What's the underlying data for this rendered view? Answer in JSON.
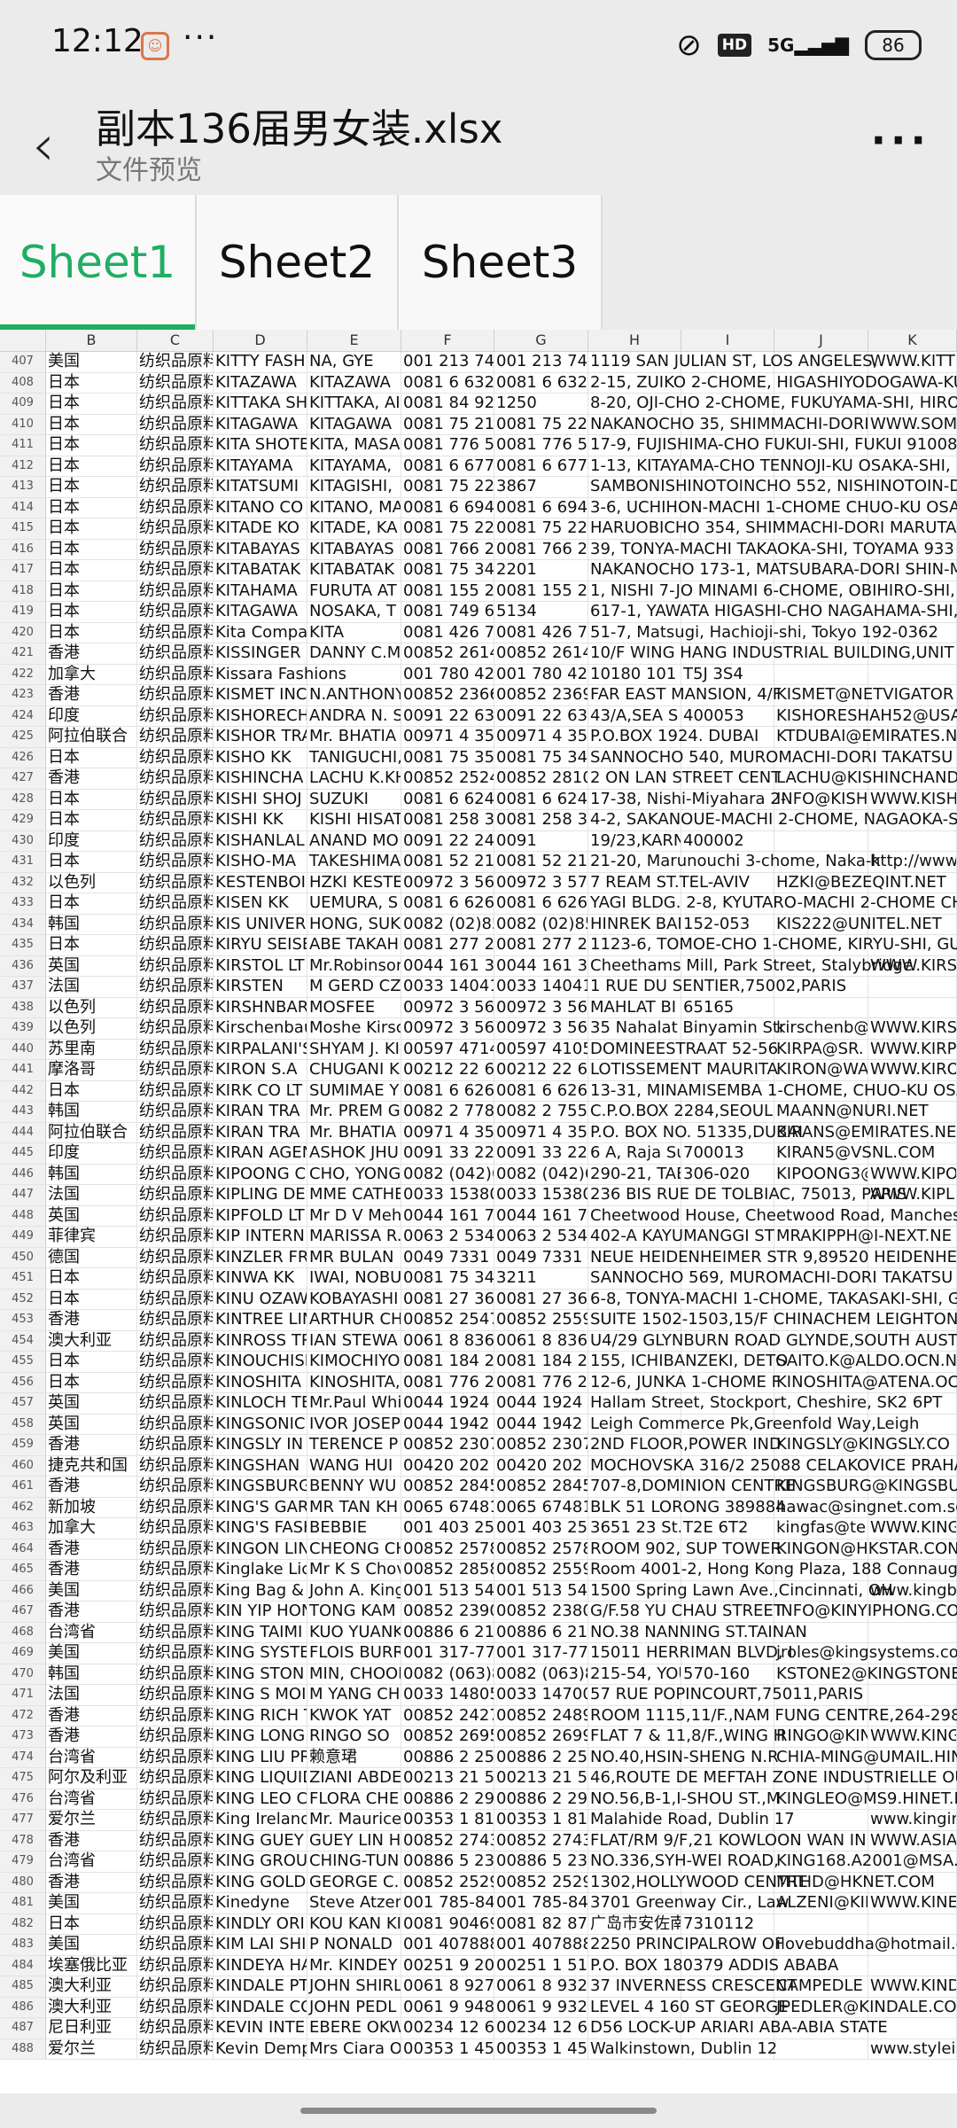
{
  "status_bar": {
    "time": "12:12",
    "more": "···",
    "network": "5G",
    "battery": "86"
  },
  "header": {
    "title": "副本136届男女装.xlsx",
    "subtitle": "文件预览"
  },
  "tabs": [
    {
      "label": "Sheet1",
      "active": true
    },
    {
      "label": "Sheet2",
      "active": false
    },
    {
      "label": "Sheet3",
      "active": false
    }
  ],
  "columns": [
    "B",
    "C",
    "D",
    "E",
    "F",
    "G",
    "H",
    "I",
    "J",
    "K"
  ],
  "rows": [
    {
      "n": "407",
      "B": "美国",
      "C": "纺织品原料",
      "D": "KITTY FASH",
      "E": "NA, GYE",
      "F": "001 213 747",
      "G": "001 213 749",
      "H": "1119 SAN JULIAN ST, LOS ANGELES,",
      "K": "WWW.KITT"
    },
    {
      "n": "408",
      "B": "日本",
      "C": "纺织品原料",
      "D": "KITAZAWA",
      "E": "KITAZAWA",
      "F": "0081 6 6328",
      "G": "0081 6 6328",
      "H": "2-15, ZUIKO 2-CHOME, HIGASHIYODOGAWA-KU"
    },
    {
      "n": "409",
      "B": "日本",
      "C": "纺织品原料",
      "D": "KITTAKA SH",
      "E": "KITTAKA, AI",
      "F": "0081 84 924",
      "G": "1250",
      "H": "8-20, OJI-CHO 2-CHOME, FUKUYAMA-SHI, HIRO"
    },
    {
      "n": "410",
      "B": "日本",
      "C": "纺织品原料",
      "D": "KITAGAWA",
      "E": "KITAGAWA",
      "F": "0081 75 211",
      "G": "0081 75 221",
      "H": "NAKANOCHO 35, SHIMMACHI-DORI",
      "K": "WWW.SOM"
    },
    {
      "n": "411",
      "B": "日本",
      "C": "纺织品原料",
      "D": "KITA SHOTE",
      "E": "KITA, MASA",
      "F": "0081 776 57",
      "G": "0081 776 57",
      "H": "17-9, FUJISHIMA-CHO FUKUI-SHI, FUKUI 910082"
    },
    {
      "n": "412",
      "B": "日本",
      "C": "纺织品原料",
      "D": "KITAYAMA",
      "E": "KITAYAMA,",
      "F": "0081 6 6772",
      "G": "0081 6 6771",
      "H": "1-13, KITAYAMA-CHO TENNOJI-KU OSAKA-SHI,"
    },
    {
      "n": "413",
      "B": "日本",
      "C": "纺织品原料",
      "D": "KITATSUMI",
      "E": "KITAGISHI,",
      "F": "0081 75 221",
      "G": "3867",
      "H": "SAMBONISHINOTOINCHO 552, NISHINOTOIN-D"
    },
    {
      "n": "414",
      "B": "日本",
      "C": "纺织品原料",
      "D": "KITANO CO",
      "E": "KITANO, MA",
      "F": "0081 6 6942",
      "G": "0081 6 6943",
      "H": "3-6, UCHIHON-MACHI 1-CHOME CHUO-KU OSA"
    },
    {
      "n": "415",
      "B": "日本",
      "C": "纺织品原料",
      "D": "KITADE KO",
      "E": "KITADE, KA",
      "F": "0081 75 221",
      "G": "0081 75 221",
      "H": "HARUOBICHO 354, SHIMMACHI-DORI MARUTA-"
    },
    {
      "n": "416",
      "B": "日本",
      "C": "纺织品原料",
      "D": "KITABAYAS",
      "E": "KITABAYAS",
      "F": "0081 766 21",
      "G": "0081 766 21",
      "H": "39, TONYA-MACHI TAKAOKA-SHI, TOYAMA 933"
    },
    {
      "n": "417",
      "B": "日本",
      "C": "纺织品原料",
      "D": "KITABATAK",
      "E": "KITABATAK",
      "F": "0081 75 341",
      "G": "2201",
      "H": "NAKANOCHO 173-1, MATSUBARA-DORI SHIN-M"
    },
    {
      "n": "418",
      "B": "日本",
      "C": "纺织品原料",
      "D": "KITAHAMA",
      "E": "FURUTA AT",
      "F": "0081 155 22",
      "G": "0081 155 23",
      "H": "1, NISHI 7-JO MINAMI 6-CHOME, OBIHIRO-SHI, H"
    },
    {
      "n": "419",
      "B": "日本",
      "C": "纺织品原料",
      "D": "KITAGAWA",
      "E": "NOSAKA, T",
      "F": "0081 749 62",
      "G": "5134",
      "H": "617-1, YAWATA HIGASHI-CHO NAGAHAMA-SHI,"
    },
    {
      "n": "420",
      "B": "日本",
      "C": "纺织品原料",
      "D": "Kita Compa",
      "E": "KITA",
      "F": "0081 426 75",
      "G": "0081 426 78",
      "H": "51-7, Matsugi, Hachioji-shi, Tokyo 192-0362"
    },
    {
      "n": "421",
      "B": "香港",
      "C": "纺织品原料",
      "D": "KISSINGER",
      "E": "DANNY C.M",
      "F": "00852 2614",
      "G": "00852 2614",
      "H": "10/F WING HANG INDUSTRIAL BUILDING,UNIT 9"
    },
    {
      "n": "422",
      "B": "加拿大",
      "C": "纺织品原料",
      "D": "Kissara Fashions",
      "F": "001 780 42",
      "G": "001 780 42",
      "H": "10180 101 St",
      "I": "T5J 3S4"
    },
    {
      "n": "423",
      "B": "香港",
      "C": "纺织品原料",
      "D": "KISMET INC",
      "E": "N.ANTHONY",
      "F": "00852 2366",
      "G": "00852 2369",
      "H": "FAR EAST MANSION, 4/F",
      "J": "KISMET@NETVIGATOR"
    },
    {
      "n": "424",
      "B": "印度",
      "C": "纺织品原料",
      "D": "KISHORECH",
      "E": "ANDRA N. S",
      "F": "0091 22 631",
      "G": "0091 22 632",
      "H": "43/A,SEA S",
      "I": "400053",
      "J": "KISHORESHAH52@USA"
    },
    {
      "n": "425",
      "B": "阿拉伯联合",
      "C": "纺织品原料",
      "D": "KISHOR TRA",
      "E": "Mr. BHATIA",
      "F": "00971 4 353",
      "G": "00971 4 353",
      "H": "P.O.BOX 1924. DUBAI",
      "J": "KTDUBAI@EMIRATES.N"
    },
    {
      "n": "426",
      "B": "日本",
      "C": "纺织品原料",
      "D": "KISHO KK",
      "E": "TANIGUCHI,",
      "F": "0081 75 351",
      "G": "0081 75 344",
      "H": "SANNOCHO 540, MUROMACHI-DORI TAKATSU"
    },
    {
      "n": "427",
      "B": "香港",
      "C": "纺织品原料",
      "D": "KISHINCHA",
      "E": "LACHU K.KH",
      "F": "00852 2524",
      "G": "00852 2810",
      "H": "2 ON LAN STREET CENT",
      "J": "LACHU@KISHINCHAND"
    },
    {
      "n": "428",
      "B": "日本",
      "C": "纺织品原料",
      "D": "KISHI SHOJ",
      "E": "SUZUKI",
      "F": "0081 6 6241",
      "G": "0081 6 6241",
      "H": "17-38, Nishi-Miyahara 2-",
      "J": "INFO@KISH",
      "K": "WWW.KISH"
    },
    {
      "n": "429",
      "B": "日本",
      "C": "纺织品原料",
      "D": "KISHI KK",
      "E": "KISHI HISAT",
      "F": "0081 258 35",
      "G": "0081 258 35",
      "H": "4-2, SAKANOUE-MACHI 2-CHOME, NAGAOKA-S"
    },
    {
      "n": "430",
      "B": "印度",
      "C": "纺织品原料",
      "D": "KISHANLAL",
      "E": "ANAND MO",
      "F": "0091 22 240",
      "G": "0091",
      "H": "19/23,KARN",
      "I": "400002"
    },
    {
      "n": "431",
      "B": "日本",
      "C": "纺织品原料",
      "D": "KISHO-MA",
      "E": "TAKESHIMA",
      "F": "0081 52 212",
      "G": "0081 52 212",
      "H": "21-20, Marunouchi 3-chome, Naka-k",
      "K": "http://www"
    },
    {
      "n": "432",
      "B": "以色列",
      "C": "纺织品原料",
      "D": "KESTENBOI",
      "E": "HZKI KESTE",
      "F": "00972 3 56",
      "G": "00972 3 570",
      "H": "7 REAM ST.TEL-AVIV",
      "J": "HZKI@BEZEQINT.NET"
    },
    {
      "n": "433",
      "B": "日本",
      "C": "纺织品原料",
      "D": "KISEN KK",
      "E": "UEMURA, S",
      "F": "0081 6 6261",
      "G": "0081 6 6261",
      "H": "YAGI BLDG. 2-8, KYUTARO-MACHI 2-CHOME CH"
    },
    {
      "n": "434",
      "B": "韩国",
      "C": "纺织品原料",
      "D": "KIS UNIVER",
      "E": "HONG, SUK",
      "F": "0082 (02)85",
      "G": "0082 (02)85",
      "H": "HINREK BAN",
      "I": "152-053",
      "J": "KIS222@UNITEL.NET"
    },
    {
      "n": "435",
      "B": "日本",
      "C": "纺织品原料",
      "D": "KIRYU SEISE",
      "E": "ABE TAKAH",
      "F": "0081 277 22",
      "G": "0081 277 22",
      "H": "1123-6, TOMOE-CHO 1-CHOME, KIRYU-SHI, GUN"
    },
    {
      "n": "436",
      "B": "英国",
      "C": "纺织品原料",
      "D": "KIRSTOL LT",
      "E": "Mr.Robinson",
      "F": "0044 161 33",
      "G": "0044 161 33",
      "H": "Cheethams Mill, Park Street, Stalybridge",
      "K": "WWW.KIRS"
    },
    {
      "n": "437",
      "B": "法国",
      "C": "纺织品原料",
      "D": "KIRSTEN",
      "E": "M GERD CZI",
      "F": "0033 14041",
      "G": "0033 14041",
      "H": "1 RUE DU SENTIER,75002,PARIS"
    },
    {
      "n": "438",
      "B": "以色列",
      "C": "纺织品原料",
      "D": "KIRSHNBAR",
      "E": "MOSFEE",
      "F": "00972 3 56",
      "G": "00972 3 56",
      "H": "MAHLAT BI",
      "I": "65165"
    },
    {
      "n": "439",
      "B": "以色列",
      "C": "纺织品原料",
      "D": "Kirschenbau",
      "E": "Moshe Kirsc",
      "F": "00972 3 56",
      "G": "00972 3 56",
      "H": "35 Nahalat Binyamin Str",
      "J": "kirschenb@",
      "K": "WWW.KIRS"
    },
    {
      "n": "440",
      "B": "苏里南",
      "C": "纺织品原料",
      "D": "KIRPALANI'S",
      "E": "SHYAM J. KI",
      "F": "00597 4714",
      "G": "00597 4105",
      "H": "DOMINEESTRAAT 52-56",
      "J": "KIRPA@SR.",
      "K": "WWW.KIRP"
    },
    {
      "n": "441",
      "B": "摩洛哥",
      "C": "纺织品原料",
      "D": "KIRON S.A",
      "E": "CHUGANI K",
      "F": "00212 22 66",
      "G": "00212 22 66",
      "H": "LOTISSEMENT MAURITA",
      "J": "KIRON@WA",
      "K": "WWW.KIRO"
    },
    {
      "n": "442",
      "B": "日本",
      "C": "纺织品原料",
      "D": "KIRK CO LT",
      "E": "SUMIMAE Y",
      "F": "0081 6 6261",
      "G": "0081 6 6265",
      "H": "13-31, MINAMISEMBA 1-CHOME, CHUO-KU OSAK"
    },
    {
      "n": "443",
      "B": "韩国",
      "C": "纺织品原料",
      "D": "KIRAN TRA",
      "E": "Mr. PREM G",
      "F": "0082 2 778",
      "G": "0082 2 755",
      "H": "C.P.O.BOX 2284,SEOUL",
      "J": "MAANN@NURI.NET"
    },
    {
      "n": "444",
      "B": "阿拉伯联合",
      "C": "纺织品原料",
      "D": "KIRAN TRA",
      "E": "Mr. BHATIA",
      "F": "00971 4 353",
      "G": "00971 4 353",
      "H": "P.O. BOX NO. 51335,DUBAI",
      "J": "KIRANS@EMIRATES.NE"
    },
    {
      "n": "445",
      "B": "印度",
      "C": "纺织品原料",
      "D": "KIRAN AGEN",
      "E": "ASHOK JHU",
      "F": "0091 33 223",
      "G": "0091 33 224",
      "H": "6 A, Raja Su",
      "I": "700013",
      "J": "KIRAN5@VSNL.COM"
    },
    {
      "n": "446",
      "B": "韩国",
      "C": "纺织品原料",
      "D": "KIPOONG C",
      "E": "CHO, YONG",
      "F": "0082 (042)6",
      "G": "0082 (042)6",
      "H": "290-21, TAE",
      "I": "306-020",
      "J": "KIPOONG3@",
      "K": "WWW.KIPO"
    },
    {
      "n": "447",
      "B": "法国",
      "C": "纺织品原料",
      "D": "KIPLING DE",
      "E": "MME CATHE",
      "F": "0033 15380",
      "G": "0033 15380",
      "H": "236 BIS RUE DE TOLBIAC, 75013, PARIS",
      "K": "WWW.KIPL"
    },
    {
      "n": "448",
      "B": "英国",
      "C": "纺织品原料",
      "D": "KIPFOLD LT",
      "E": "Mr D V Meh",
      "F": "0044 161 79",
      "G": "0044 161 70",
      "H": "Cheetwood House, Cheetwood Road, Manchester"
    },
    {
      "n": "449",
      "B": "菲律宾",
      "C": "纺织品原料",
      "D": "KIP INTERN",
      "E": "MARISSA R.",
      "F": "0063 2 534",
      "G": "0063 2 534",
      "H": "402-A KAYUMANGGI ST",
      "J": "MRAKIPPH@I-NEXT.NE"
    },
    {
      "n": "450",
      "B": "德国",
      "C": "纺织品原料",
      "D": "KINZLER FR",
      "E": "MR BULAN",
      "F": "0049 7331",
      "G": "0049 7331 4",
      "H": "NEUE HEIDENHEIMER STR 9,89520 HEIDENHEIM"
    },
    {
      "n": "451",
      "B": "日本",
      "C": "纺织品原料",
      "D": "KINWA KK",
      "E": "IWAI, NOBU",
      "F": "0081 75 341",
      "G": "3211",
      "H": "SANNOCHO 569, MUROMACHI-DORI TAKATSU"
    },
    {
      "n": "452",
      "B": "日本",
      "C": "纺织品原料",
      "D": "KINU OZAW",
      "E": "KOBAYASHI",
      "F": "0081 27 361",
      "G": "0081 27 362",
      "H": "6-8, TONYA-MACHI 1-CHOME, TAKASAKI-SHI, G"
    },
    {
      "n": "453",
      "B": "香港",
      "C": "纺织品原料",
      "D": "KINTREE LIN",
      "E": "ARTHUR CH",
      "F": "00852 2547",
      "G": "00852 2559",
      "H": "SUITE 1502-1503,15/F CHINACHEM LEIGHTON P"
    },
    {
      "n": "454",
      "B": "澳大利亚",
      "C": "纺织品原料",
      "D": "KINROSS TR",
      "E": "IAN STEWA",
      "F": "0061 8 836",
      "G": "0061 8 836",
      "H": "U4/29 GLYNBURN ROAD GLYNDE,SOUTH AUST"
    },
    {
      "n": "455",
      "B": "日本",
      "C": "纺织品原料",
      "D": "KINOUCHISH",
      "E": "KIMOCHIYO",
      "F": "0081 184 22",
      "G": "0081 184 23",
      "H": "155, ICHIBANZEKI, DETO",
      "J": "SAITO.K@ALDO.OCN.N"
    },
    {
      "n": "456",
      "B": "日本",
      "C": "纺织品原料",
      "D": "KINOSHITA",
      "E": "KINOSHITA,",
      "F": "0081 776 22",
      "G": "0081 776 27",
      "H": "12-6, JUNKA 1-CHOME F",
      "J": "KINOSHITA@ATENA.OC"
    },
    {
      "n": "457",
      "B": "英国",
      "C": "纺织品原料",
      "D": "KINLOCH TE",
      "E": "Mr.Paul Whi",
      "F": "0044 1924",
      "G": "0044 1924",
      "H": "Hallam Street, Stockport, Cheshire, SK2 6PT"
    },
    {
      "n": "458",
      "B": "英国",
      "C": "纺织品原料",
      "D": "KINGSONIC",
      "E": "IVOR JOSEP",
      "F": "0044 1942",
      "G": "0044 1942",
      "H": "Leigh Commerce Pk,Greenfold Way,Leigh"
    },
    {
      "n": "459",
      "B": "香港",
      "C": "纺织品原料",
      "D": "KINGSLY IN",
      "E": "TERENCE P",
      "F": "00852 2307",
      "G": "00852 2307",
      "H": "2ND FLOOR,POWER IND",
      "J": "KINGSLY@KINGSLY.CO"
    },
    {
      "n": "460",
      "B": "捷克共和国",
      "C": "纺织品原料",
      "D": "KINGSHAN",
      "E": "WANG HUI",
      "F": "00420 202",
      "G": "00420 202",
      "H": "MOCHOVSKA 316/2 25088 CELAKOVICE PRAHA"
    },
    {
      "n": "461",
      "B": "香港",
      "C": "纺织品原料",
      "D": "KINGSBURG",
      "E": "BENNY WU",
      "F": "00852 2845",
      "G": "00852 2845",
      "H": "707-8,DOMINION CENTRE",
      "J": "KINGSBURG@KINGSBU"
    },
    {
      "n": "462",
      "B": "新加坡",
      "C": "纺织品原料",
      "D": "KING'S GARI",
      "E": "MR TAN KH",
      "F": "0065 67481",
      "G": "0065 67481",
      "H": "BLK 51 LORONG 389884",
      "J": "hawac@singnet.com.sg"
    },
    {
      "n": "463",
      "B": "加拿大",
      "C": "纺织品原料",
      "D": "KING'S FASH",
      "E": "BEBBIE",
      "F": "001 403 25",
      "G": "001 403 25",
      "H": "3651 23 St.",
      "I": "T2E 6T2",
      "J": "kingfas@te",
      "K": "WWW.KING"
    },
    {
      "n": "464",
      "B": "香港",
      "C": "纺织品原料",
      "D": "KINGON LIN",
      "E": "CHEONG CH",
      "F": "00852 2578",
      "G": "00852 2578",
      "H": "ROOM 902, SUP TOWER",
      "J": "KINGON@HKSTAR.CON"
    },
    {
      "n": "465",
      "B": "香港",
      "C": "纺织品原料",
      "D": "Kinglake Lic",
      "E": "Mr K S Chov",
      "F": "00852 2858",
      "G": "00852 2559",
      "H": "Room 4001-2, Hong Kong Plaza, 188 Connaught"
    },
    {
      "n": "466",
      "B": "美国",
      "C": "纺织品原料",
      "D": "King Bag &",
      "E": "John A. King",
      "F": "001 513 541",
      "G": "001 513 541",
      "H": "1500 Spring Lawn Ave.,Cincinnati, OH",
      "K": "www.kingba"
    },
    {
      "n": "467",
      "B": "香港",
      "C": "纺织品原料",
      "D": "KIN YIP HON",
      "E": "TONG KAM",
      "F": "00852 2390",
      "G": "00852 2380",
      "H": "G/F.58 YU CHAU STREET",
      "J": "INFO@KINYIPHONG.CO"
    },
    {
      "n": "468",
      "B": "台湾省",
      "C": "纺织品原料",
      "D": "KING TAIMI",
      "E": "KUO YUANK",
      "F": "00886 6 213",
      "G": "00886 6 213",
      "H": "NO.38 NANNING ST.TAINAN"
    },
    {
      "n": "469",
      "B": "美国",
      "C": "纺织品原料",
      "D": "KING SYSTE",
      "E": "FLOIS BURR",
      "F": "001 317-776",
      "G": "001 317-776",
      "H": "15011 HERRIMAN BLVD, I",
      "J": "jroles@kingsystems.cor"
    },
    {
      "n": "470",
      "B": "韩国",
      "C": "纺织品原料",
      "D": "KING STON",
      "E": "MIN, CHOON",
      "F": "0082 (063)8",
      "G": "0082 (063)8",
      "H": "215-54, YOU",
      "I": "570-160",
      "J": "KSTONE2@KINGSTONE"
    },
    {
      "n": "471",
      "B": "法国",
      "C": "纺织品原料",
      "D": "KING S MOI",
      "E": "M YANG CH",
      "F": "0033 14805",
      "G": "0033 14700",
      "H": "57 RUE POPINCOURT,75011,PARIS"
    },
    {
      "n": "472",
      "B": "香港",
      "C": "纺织品原料",
      "D": "KING RICH T",
      "E": "KWOK YAT",
      "F": "00852 2427",
      "G": "00852 2489",
      "H": "ROOM 1115,11/F.,NAM FUNG CENTRE,264-298,C"
    },
    {
      "n": "473",
      "B": "香港",
      "C": "纺织品原料",
      "D": "KING LONG",
      "E": "RINGO SO",
      "F": "00852 2695",
      "G": "00852 2699",
      "H": "FLAT 7 & 11,8/F.,WING H",
      "J": "RINGO@KIN",
      "K": "WWW.KING"
    },
    {
      "n": "474",
      "B": "台湾省",
      "C": "纺织品原料",
      "D": "KING LIU PR",
      "E": "赖意珺",
      "F": "00886 2 25",
      "G": "00886 2 25",
      "H": "NO.40,HSIN-SHENG N.R",
      "J": "CHIA-MING@UMAIL.HIN"
    },
    {
      "n": "475",
      "B": "阿尔及利亚",
      "C": "纺织品原料",
      "D": "KING LIQUID",
      "E": "ZIANI ABDE",
      "F": "00213 21 51",
      "G": "00213 21 51",
      "H": "46,ROUTE DE MEFTAH ZONE INDUSTRIELLE OU"
    },
    {
      "n": "476",
      "B": "台湾省",
      "C": "纺织品原料",
      "D": "KING LEO C",
      "E": "FLORA CHE",
      "F": "00886 2 29",
      "G": "00886 2 29",
      "H": "NO.56,B-1,I-SHOU ST.,M",
      "J": "KINGLEO@MS9.HINET.N"
    },
    {
      "n": "477",
      "B": "爱尔兰",
      "C": "纺织品原料",
      "D": "King Ireland",
      "E": "Mr. Maurice",
      "F": "00353 1 816",
      "G": "00353 1 816",
      "H": "Malahide Road, Dublin 17",
      "K": "www.kingire"
    },
    {
      "n": "478",
      "B": "香港",
      "C": "纺织品原料",
      "D": "KING GUEY",
      "E": "GUEY LIN H",
      "F": "00852 2743",
      "G": "00852 2743",
      "H": "FLAT/RM 9/F,21 KOWLOON WAN IN",
      "K": "WWW.ASIA"
    },
    {
      "n": "479",
      "B": "台湾省",
      "C": "纺织品原料",
      "D": "KING GROU",
      "E": "CHING-TUN",
      "F": "00886 5 23",
      "G": "00886 5 23",
      "H": "NO.336,SYH-WEI ROAD,",
      "J": "KING168.A2001@MSA.H"
    },
    {
      "n": "480",
      "B": "香港",
      "C": "纺织品原料",
      "D": "KING GOLD",
      "E": "GEORGE C.",
      "F": "00852 2529",
      "G": "00852 2529",
      "H": "1302,HOLLYWOOD CENTRE",
      "J": "MTHD@HKNET.COM"
    },
    {
      "n": "481",
      "B": "美国",
      "C": "纺织品原料",
      "D": "Kinedyne",
      "E": "Steve Atzen",
      "F": "001 785-84",
      "G": "001 785-84",
      "H": "3701 Greenway Cir., Law",
      "J": "ALZENI@KII",
      "K": "WWW.KINE"
    },
    {
      "n": "482",
      "B": "日本",
      "C": "纺织品原料",
      "D": "KINDLY ORI",
      "E": "KOU KAN KI",
      "F": "0081 90469",
      "G": "0081 82 871",
      "H": "广岛市安佐南区",
      "I": "7310112"
    },
    {
      "n": "483",
      "B": "美国",
      "C": "纺织品原料",
      "D": "KIM LAI SHI",
      "E": "P NONALD",
      "F": "001 407888",
      "G": "001 407888",
      "H": "2250 PRINCIPALROW OF",
      "J": "ilovebuddha@hotmail.co"
    },
    {
      "n": "484",
      "B": "埃塞俄比亚",
      "C": "纺织品原料",
      "D": "KINDEYA HA",
      "E": "Mr. KINDEY",
      "F": "00251 9 20",
      "G": "00251 1 513",
      "H": "P.O. BOX 180379 ADDIS ABABA"
    },
    {
      "n": "485",
      "B": "澳大利亚",
      "C": "纺织品原料",
      "D": "KINDALE PT",
      "E": "JOHN SHIRL",
      "F": "0061 8 9271",
      "G": "0061 8 932",
      "H": "37 INVERNESS CRESCENT",
      "J": "CAMPEDLE",
      "K": "WWW.KIND"
    },
    {
      "n": "486",
      "B": "澳大利亚",
      "C": "纺织品原料",
      "D": "KINDALE CO",
      "E": "JOHN PEDL",
      "F": "0061 9 948",
      "G": "0061 9 932",
      "H": "LEVEL 4 160 ST GEORGE",
      "J": "JPEDLER@KINDALE.CO"
    },
    {
      "n": "487",
      "B": "尼日利亚",
      "C": "纺织品原料",
      "D": "KEVIN INTE",
      "E": "EBERE OKW",
      "F": "00234 12 64",
      "G": "00234 12 64",
      "H": "D56 LOCK-UP ARIARI ABA-ABIA STATE"
    },
    {
      "n": "488",
      "B": "爱尔兰",
      "C": "纺织品原料",
      "D": "Kevin Demp",
      "E": "Mrs Ciara O",
      "F": "00353 1 456",
      "G": "00353 1 456",
      "H": "Walkinstown, Dublin 12",
      "K": "www.styleir"
    }
  ]
}
